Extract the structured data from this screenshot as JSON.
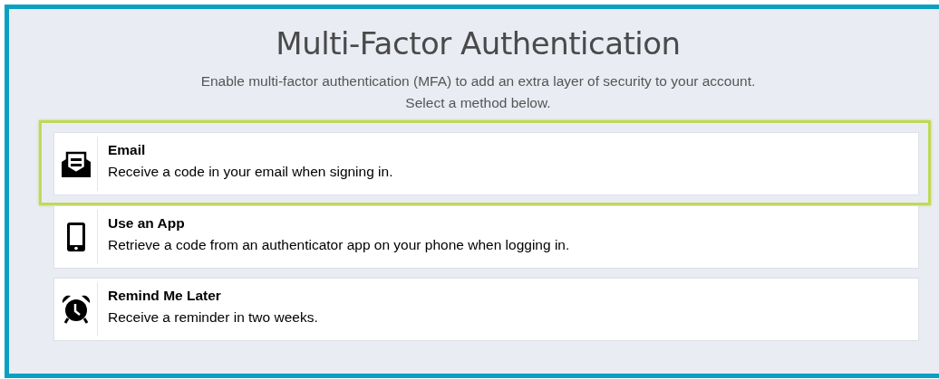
{
  "title": "Multi-Factor Authentication",
  "intro": [
    "Enable multi-factor authentication (MFA) to add an extra layer of security to your account.",
    "Select a method below."
  ],
  "methods": [
    {
      "kind": "email",
      "title": "Email",
      "description": "Receive a code in your email when signing in.",
      "selected": true
    },
    {
      "kind": "app",
      "title": "Use an App",
      "description": "Retrieve a code from an authenticator app on your phone when logging in.",
      "selected": false
    },
    {
      "kind": "later",
      "title": "Remind Me Later",
      "description": "Receive a reminder in two weeks.",
      "selected": false
    }
  ]
}
